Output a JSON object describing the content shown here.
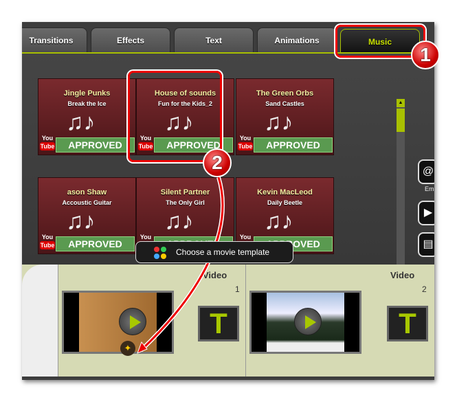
{
  "tabs": [
    {
      "label": "Transitions"
    },
    {
      "label": "Effects"
    },
    {
      "label": "Text"
    },
    {
      "label": "Animations"
    },
    {
      "label": "Music",
      "active": true
    }
  ],
  "tracks": [
    {
      "artist": "Jingle Punks",
      "song": "Break the Ice"
    },
    {
      "artist": "House of sounds",
      "song": "Fun for the Kids_2"
    },
    {
      "artist": "The Green Orbs",
      "song": "Sand Castles"
    },
    {
      "artist": "ason Shaw",
      "song": "Accoustic Guitar"
    },
    {
      "artist": "Silent Partner",
      "song": "The Only Girl"
    },
    {
      "artist": "Kevin MacLeod",
      "song": "Daily Beetle"
    }
  ],
  "badge": {
    "youtube_top": "You",
    "youtube_bottom": "Tube",
    "approved": "APPROVED"
  },
  "template_button": "Choose a movie template",
  "right_panel": {
    "email_label": "Ema"
  },
  "clips": [
    {
      "label": "Video",
      "number": "1",
      "text_tile": "T"
    },
    {
      "label": "Video",
      "number": "2",
      "text_tile": "T"
    }
  ],
  "annotations": {
    "step1": "1",
    "step2": "2"
  },
  "colors": {
    "accent": "#a8c000",
    "annotation": "#e00000"
  }
}
